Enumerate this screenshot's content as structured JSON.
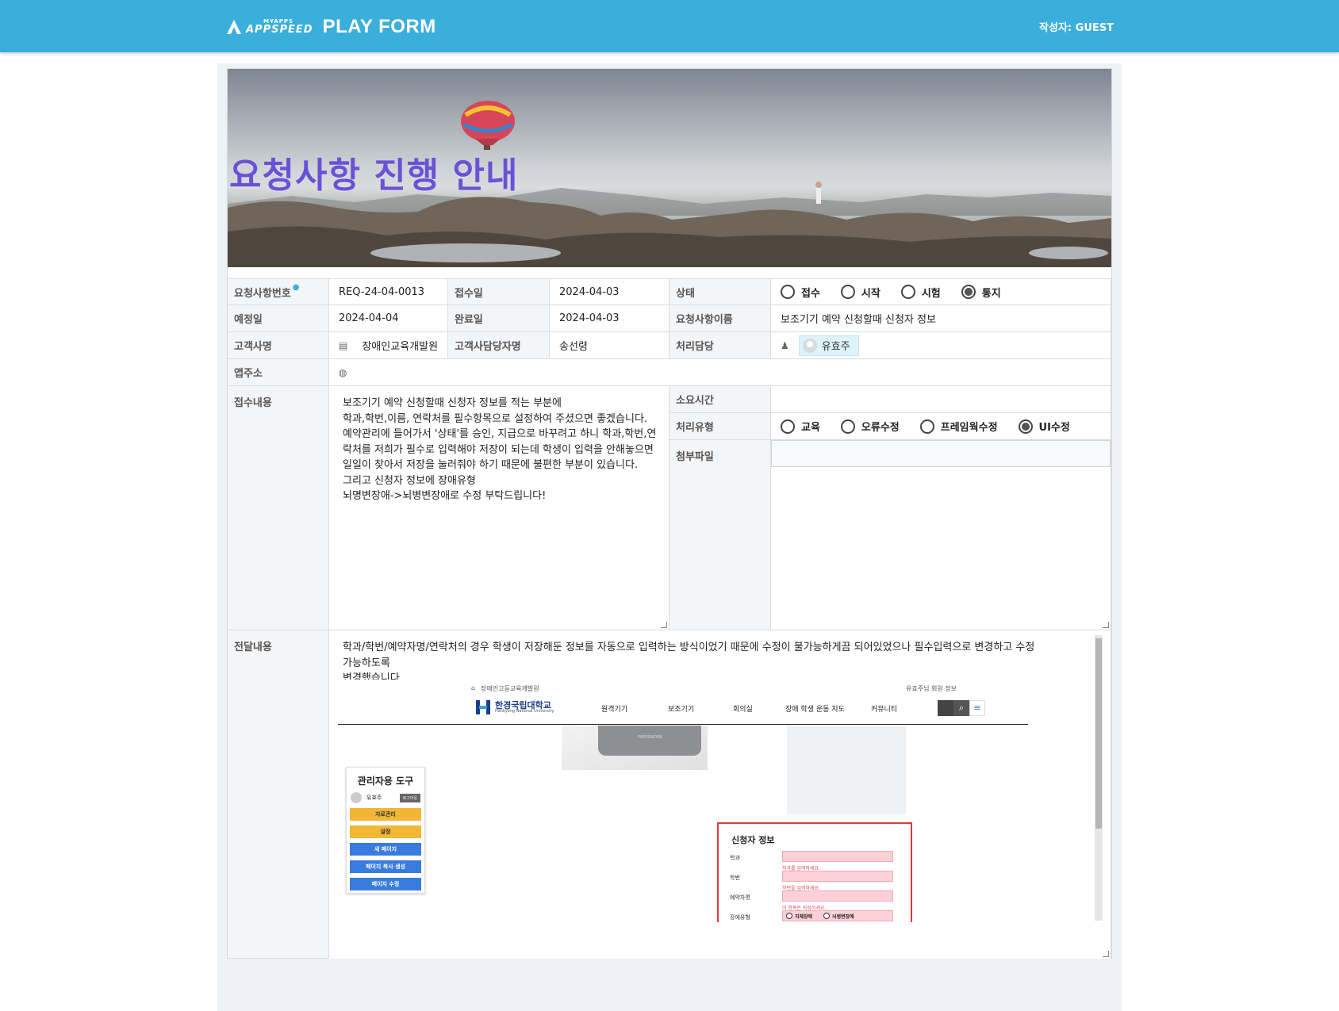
{
  "header": {
    "logo_small": "MYAPPS",
    "logo_big": "APPSPEED",
    "title": "PLAY FORM",
    "author": "작성자: GUEST"
  },
  "banner": {
    "title": "요청사항 진행 안내"
  },
  "form": {
    "req_no_label": "요청사항번호",
    "req_no": "REQ-24-04-0013",
    "received_label": "접수일",
    "received": "2024-04-03",
    "status_label": "상태",
    "status_options": [
      "접수",
      "시작",
      "시험",
      "통지"
    ],
    "status_selected": "통지",
    "due_label": "예정일",
    "due": "2024-04-04",
    "done_label": "완료일",
    "done": "2024-04-03",
    "req_name_label": "요청사항이름",
    "req_name": "보조기기 예약 신청할때 신청자 정보",
    "customer_label": "고객사명",
    "customer": "장애인교육개발원",
    "contact_label": "고객사담당자명",
    "contact": "송선령",
    "handler_label": "처리담당",
    "handler": "유효주",
    "app_url_label": "앱주소",
    "content_label": "접수내용",
    "content_lines": [
      "보조기기 예약 신청할때 신청자 정보를 적는 부분에",
      "학과,학번,이름, 연락처를 필수항목으로 설정하여 주셨으면 좋겠습니다.",
      "예약관리에 들어가서 '상태'를 승인, 지급으로 바꾸려고 하니 학과,학번,연",
      "락처를 저희가 필수로 입력해야 저장이 되는데 학생이 입력을 안해놓으면",
      "일일이 찾아서 저장을 눌러줘야 하기 때문에 불편한 부분이 있습니다.",
      "그리고 신청자 정보에 장애유형",
      "뇌명변장애->뇌병변장애로 수정 부탁드립니다!"
    ],
    "time_label": "소요시간",
    "type_label": "처리유형",
    "type_options": [
      "교육",
      "오류수정",
      "프레임웍수정",
      "UI수정"
    ],
    "type_selected": "UI수정",
    "attach_label": "첨부파일",
    "delivery_label": "전달내용",
    "delivery_lines": [
      "학과/학번/예약자명/연락처의 경우 학생이 저장해둔 정보를 자동으로 입력하는 방식이었기 때문에 수정이 불가능하게끔 되어있었으나 필수입력으로 변경하고 수정 가능하도록",
      "변경했습니다."
    ]
  },
  "screenshot": {
    "breadcrumb": "장애인고등교육개발원",
    "user_info": "유효주님 회원 정보",
    "univ_name": "한경국립대학교",
    "univ_sub": "Hankyong National University",
    "nav": [
      "원격기기",
      "보조기기",
      "회의실",
      "장애 학생 운동 지도",
      "커뮤니티"
    ],
    "admin_title": "관리자용 도구",
    "admin_user": "유효주",
    "admin_logout": "로그아웃",
    "admin_buttons": [
      "자료관리",
      "설정",
      "새 페이지",
      "페이지 복사 생성",
      "페이지 수정"
    ],
    "applicant_title": "신청자 정보",
    "applicant_fields": [
      "학과",
      "학번",
      "예약자명",
      "장애유형"
    ],
    "hint_dept": "학과를 입력하세요.",
    "hint_id": "학번을 입력하세요.",
    "hint_name": "이 항목은 작성하세요.",
    "disability_options": [
      "지체장애",
      "뇌병변장애"
    ],
    "device_brand": "PAPERWORK"
  }
}
